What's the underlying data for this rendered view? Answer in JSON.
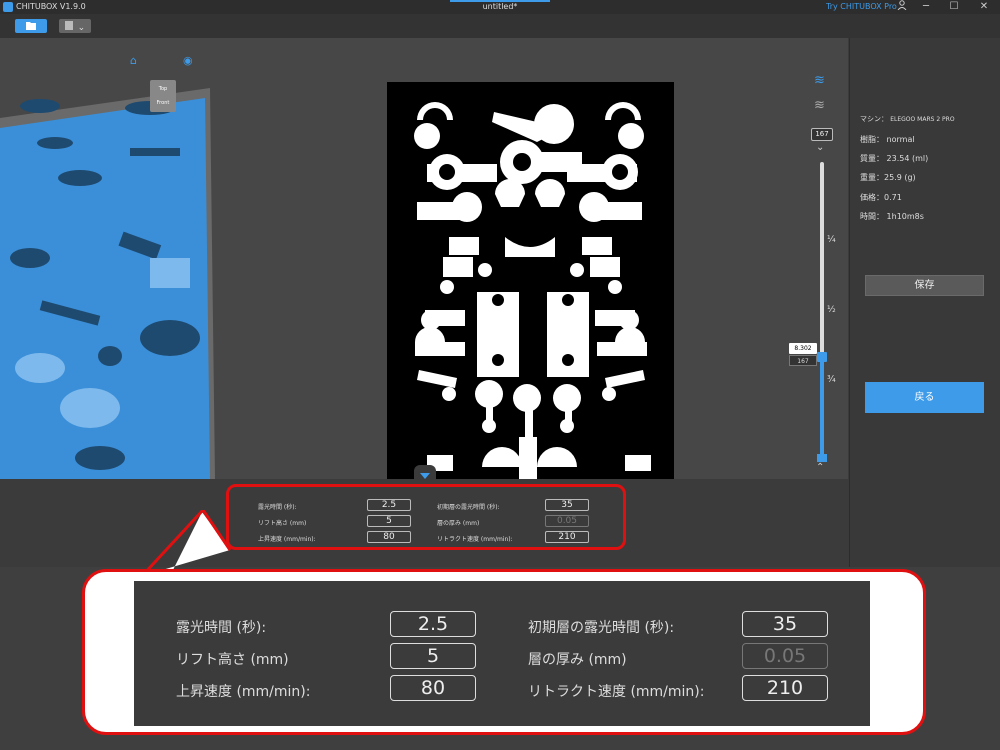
{
  "titlebar": {
    "app_name": "CHITUBOX V1.9.0",
    "document": "untitled*",
    "try_pro": "Try CHITUBOX Pro",
    "user_icon": "user-icon",
    "minimize": "─",
    "maximize": "☐",
    "close": "✕"
  },
  "toolbar": {
    "open_icon": "folder-icon",
    "save_icon": "disk-icon",
    "dropdown": "⌄"
  },
  "view_cube": {
    "top": "Top",
    "front": "Front"
  },
  "slider": {
    "max_layer": "167",
    "current_height": "8.302",
    "current_layer": "167",
    "marks": [
      "¼",
      "½",
      "¾"
    ],
    "chevron_up": "⌃",
    "chevron_down": "⌄",
    "fill_fraction": 1.0
  },
  "info": {
    "machine_label": "マシン：",
    "machine_value": "ELEGOO MARS 2 PRO",
    "resin_label": "樹脂：",
    "resin_value": "normal",
    "volume_label": "質量：",
    "volume_value": "23.54  (ml)",
    "weight_label": "重量：",
    "weight_value": "25.9  (g)",
    "price_label": "価格：",
    "price_value": "0.71",
    "time_label": "時間：",
    "time_value": "1h10m8s"
  },
  "buttons": {
    "save": "保存",
    "back": "戻る"
  },
  "params": {
    "exposure_label": "露光時間 (秒):",
    "exposure_value": "2.5",
    "lift_height_label": "リフト高さ (mm)",
    "lift_height_value": "5",
    "lift_speed_label": "上昇速度 (mm/min):",
    "lift_speed_value": "80",
    "bottom_exposure_label": "初期層の露光時間 (秒):",
    "bottom_exposure_value": "35",
    "layer_height_label": "層の厚み (mm)",
    "layer_height_value": "0.05",
    "retract_speed_label": "リトラクト速度 (mm/min):",
    "retract_speed_value": "210"
  }
}
